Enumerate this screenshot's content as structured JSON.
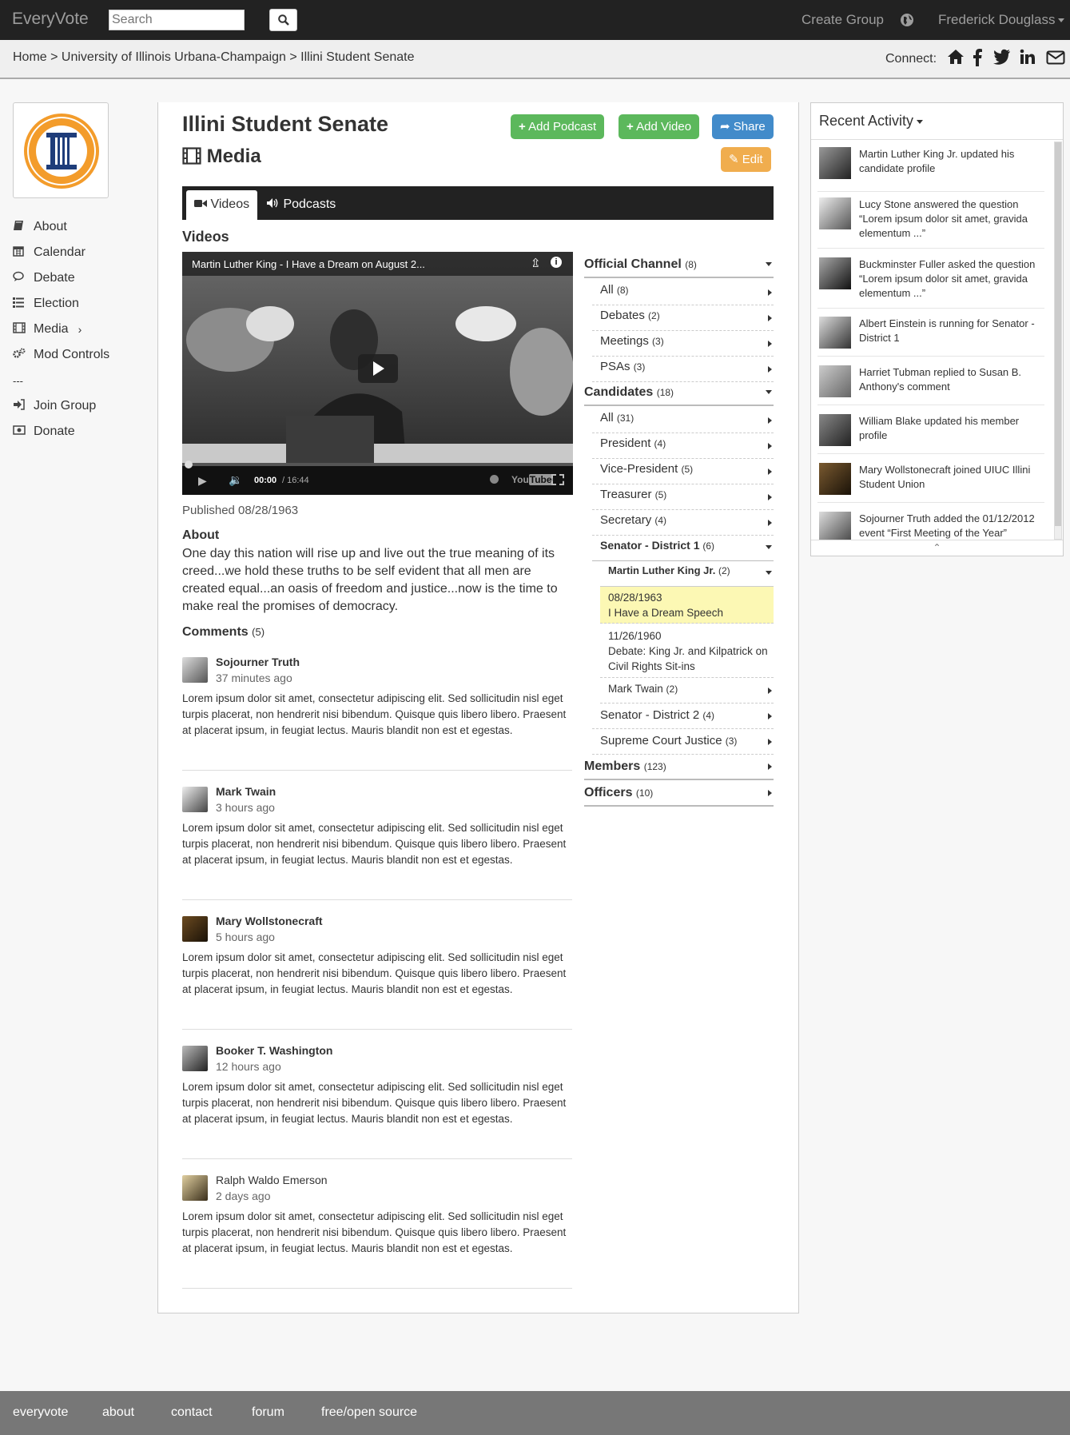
{
  "topbar": {
    "brand": "EveryVote",
    "search_placeholder": "Search",
    "create_group": "Create Group",
    "user": "Frederick Douglass"
  },
  "breadcrumb": "Home > University of Illinois Urbana-Champaign > Illini Student Senate",
  "connect_label": "Connect:",
  "sidebar": {
    "items": [
      {
        "label": "About",
        "icon": "book-icon"
      },
      {
        "label": "Calendar",
        "icon": "calendar-icon"
      },
      {
        "label": "Debate",
        "icon": "comments-icon"
      },
      {
        "label": "Election",
        "icon": "list-icon"
      },
      {
        "label": "Media",
        "icon": "film-icon"
      },
      {
        "label": "Mod Controls",
        "icon": "cogs-icon"
      },
      {
        "label": "---",
        "icon": ""
      },
      {
        "label": "Join Group",
        "icon": "sign-in-icon"
      },
      {
        "label": "Donate",
        "icon": "money-icon"
      }
    ]
  },
  "page": {
    "title": "Illini Student Senate",
    "subtitle": "Media",
    "add_podcast": "Add Podcast",
    "add_video": "Add Video",
    "share": "Share",
    "edit": "Edit"
  },
  "tabs": {
    "videos": "Videos",
    "podcasts": "Podcasts"
  },
  "videos_heading": "Videos",
  "video": {
    "title": "Martin Luther King - I Have a Dream on August 2...",
    "time": "00:00",
    "duration": "/ 16:44",
    "published": "Published 08/28/1963"
  },
  "about": {
    "heading": "About",
    "text": "One day this nation will rise up and live out the true meaning of its creed...we hold these truths to be self evident that all men are created equal...an oasis of freedom and justice...now is the time to make real the promises of democracy."
  },
  "comments_heading": "Comments",
  "comments_count": "(5)",
  "comments": [
    {
      "name": "Sojourner Truth",
      "time": "37 minutes ago",
      "text": "Lorem ipsum dolor sit amet, consectetur adipiscing elit. Sed sollicitudin nisl eget turpis placerat, non hendrerit nisi bibendum. Quisque quis libero libero. Praesent at placerat ipsum, in feugiat lectus. Mauris blandit non est et egestas."
    },
    {
      "name": "Mark Twain",
      "time": "3 hours ago",
      "text": "Lorem ipsum dolor sit amet, consectetur adipiscing elit. Sed sollicitudin nisl eget turpis placerat, non hendrerit nisi bibendum. Quisque quis libero libero. Praesent at placerat ipsum, in feugiat lectus. Mauris blandit non est et egestas."
    },
    {
      "name": "Mary Wollstonecraft",
      "time": "5 hours ago",
      "text": "Lorem ipsum dolor sit amet, consectetur adipiscing elit. Sed sollicitudin nisl eget turpis placerat, non hendrerit nisi bibendum. Quisque quis libero libero. Praesent at placerat ipsum, in feugiat lectus. Mauris blandit non est et egestas."
    },
    {
      "name": "Booker T. Washington",
      "time": "12 hours ago",
      "text": "Lorem ipsum dolor sit amet, consectetur adipiscing elit. Sed sollicitudin nisl eget turpis placerat, non hendrerit nisi bibendum. Quisque quis libero libero. Praesent at placerat ipsum, in feugiat lectus. Mauris blandit non est et egestas."
    },
    {
      "name": "Ralph Waldo Emerson",
      "time": "2 days ago",
      "text": "Lorem ipsum dolor sit amet, consectetur adipiscing elit. Sed sollicitudin nisl eget turpis placerat, non hendrerit nisi bibendum. Quisque quis libero libero. Praesent at placerat ipsum, in feugiat lectus. Mauris blandit non est et egestas."
    }
  ],
  "tree": {
    "official": {
      "label": "Official Channel",
      "count": "(8)"
    },
    "official_items": [
      {
        "label": "All",
        "count": "(8)"
      },
      {
        "label": "Debates",
        "count": "(2)"
      },
      {
        "label": "Meetings",
        "count": "(3)"
      },
      {
        "label": "PSAs",
        "count": "(3)"
      }
    ],
    "candidates": {
      "label": "Candidates",
      "count": "(18)"
    },
    "candidate_items": [
      {
        "label": "All",
        "count": "(31)"
      },
      {
        "label": "President",
        "count": "(4)"
      },
      {
        "label": "Vice-President",
        "count": "(5)"
      },
      {
        "label": "Treasurer",
        "count": "(5)"
      },
      {
        "label": "Secretary",
        "count": "(4)"
      }
    ],
    "senator1": {
      "label": "Senator - District 1",
      "count": "(6)"
    },
    "mlk": {
      "label": "Martin Luther King Jr.",
      "count": "(2)"
    },
    "mlk_videos": [
      {
        "date": "08/28/1963",
        "title": "I Have a Dream Speech"
      },
      {
        "date": "11/26/1960",
        "title": "Debate: King Jr. and Kilpatrick on Civil Rights Sit-ins"
      }
    ],
    "twain": {
      "label": "Mark Twain",
      "count": "(2)"
    },
    "senator2": {
      "label": "Senator - District 2",
      "count": "(4)"
    },
    "justice": {
      "label": "Supreme Court Justice",
      "count": "(3)"
    },
    "members": {
      "label": "Members",
      "count": "(123)"
    },
    "officers": {
      "label": "Officers",
      "count": "(10)"
    }
  },
  "recent": {
    "heading": "Recent Activity",
    "items": [
      "Martin Luther King Jr. updated his candidate profile",
      "Lucy Stone answered the question “Lorem ipsum dolor sit amet, gravida elementum ...”",
      "Buckminster Fuller asked the question “Lorem ipsum dolor sit amet, gravida elementum ...”",
      "Albert Einstein is running for Senator - District 1",
      "Harriet Tubman replied to Susan B. Anthony's comment",
      "William Blake updated his member profile",
      "Mary Wollstonecraft joined UIUC Illini Student Union",
      "Sojourner Truth added the 01/12/2012 event “First Meeting of the Year”"
    ]
  },
  "footer": [
    "everyvote",
    "about",
    "contact",
    "forum",
    "free/open source"
  ],
  "colors": {
    "green": "#5cb85c",
    "blue": "#428bca",
    "orange": "#f0ad4e",
    "highlight": "#fcf8b4"
  }
}
